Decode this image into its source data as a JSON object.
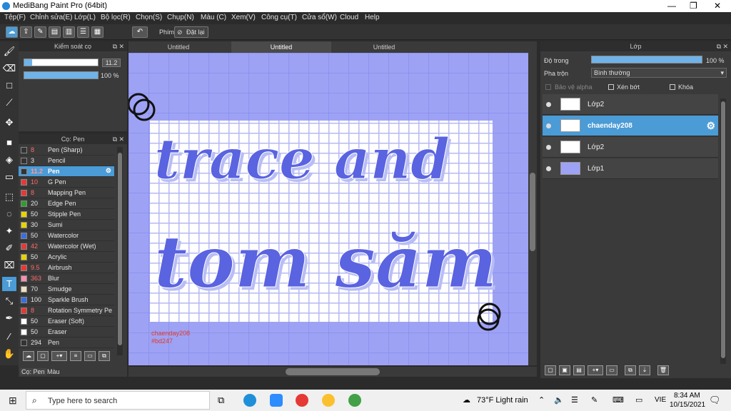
{
  "window": {
    "title": "MediBang Paint Pro (64bit)"
  },
  "menu": [
    "Tệp(F)",
    "Chỉnh sửa(E)",
    "Lớp(L)",
    "Bộ lọc(R)",
    "Chọn(S)",
    "Chụp(N)",
    "Màu (C)",
    "Xem(V)",
    "Công cụ(T)",
    "Cửa sổ(W)",
    "Cloud",
    "Help"
  ],
  "toolbar": {
    "shortcut_label": "Phím",
    "cancel_label": "Đặt lại"
  },
  "control_panel": {
    "title": "Kiểm soát cọ",
    "size_value": "11.2",
    "opacity_value": "100 %",
    "size_fraction": 0.11,
    "opacity_fraction": 1.0
  },
  "brush_panel": {
    "title": "Cọ: Pen",
    "brushes": [
      {
        "size": "8",
        "name": "Pen (Sharp)",
        "color": "#333333"
      },
      {
        "size": "3",
        "name": "Pencil",
        "color": "#333333"
      },
      {
        "size": "11.2",
        "name": "Pen",
        "color": "#333333",
        "selected": true
      },
      {
        "size": "10",
        "name": "G Pen",
        "color": "#e53935"
      },
      {
        "size": "8",
        "name": "Mapping Pen",
        "color": "#e53935"
      },
      {
        "size": "20",
        "name": "Edge Pen",
        "color": "#2e9e2e"
      },
      {
        "size": "50",
        "name": "Stipple Pen",
        "color": "#e6d400"
      },
      {
        "size": "30",
        "name": "Sumi",
        "color": "#e6d400"
      },
      {
        "size": "50",
        "name": "Watercolor",
        "color": "#3a6ee0"
      },
      {
        "size": "42",
        "name": "Watercolor (Wet)",
        "color": "#e53935"
      },
      {
        "size": "50",
        "name": "Acrylic",
        "color": "#e6d400"
      },
      {
        "size": "9.5",
        "name": "Airbrush",
        "color": "#e53935"
      },
      {
        "size": "363",
        "name": "Blur",
        "color": "#f48fb1"
      },
      {
        "size": "70",
        "name": "Smudge",
        "color": "#f0e0c0"
      },
      {
        "size": "100",
        "name": "Sparkle Brush",
        "color": "#3a6ee0"
      },
      {
        "size": "8",
        "name": "Rotation Symmetry Pe",
        "color": "#e53935"
      },
      {
        "size": "50",
        "name": "Eraser (Soft)",
        "color": "#ffffff"
      },
      {
        "size": "50",
        "name": "Eraser",
        "color": "#ffffff"
      },
      {
        "size": "294",
        "name": "Pen",
        "color": "#333333"
      }
    ],
    "bottom_tabs": [
      "Cọ: Pen",
      "Màu"
    ]
  },
  "tabs": [
    "Untitled",
    "Untitled",
    "Untitled"
  ],
  "canvas": {
    "line1": "trace and",
    "line2": "tom săm",
    "signature1": "chaenday208",
    "signature2": "#bd247"
  },
  "layer_panel": {
    "title": "Lớp",
    "opacity_label": "Độ trong",
    "opacity_value": "100 %",
    "blend_label": "Pha trộn",
    "blend_value": "Bình thường",
    "protect_alpha": "Bảo vệ alpha",
    "clipping": "Xén bớt",
    "lock": "Khóa",
    "layers": [
      {
        "name": "Lớp2"
      },
      {
        "name": "chaenday208",
        "selected": true
      },
      {
        "name": "Lớp2"
      },
      {
        "name": "Lớp1"
      }
    ]
  },
  "taskbar": {
    "search_placeholder": "Type here to search",
    "weather": "73°F  Light rain",
    "lang": "VIE",
    "time": "8:34 AM",
    "date": "10/15/2021"
  }
}
